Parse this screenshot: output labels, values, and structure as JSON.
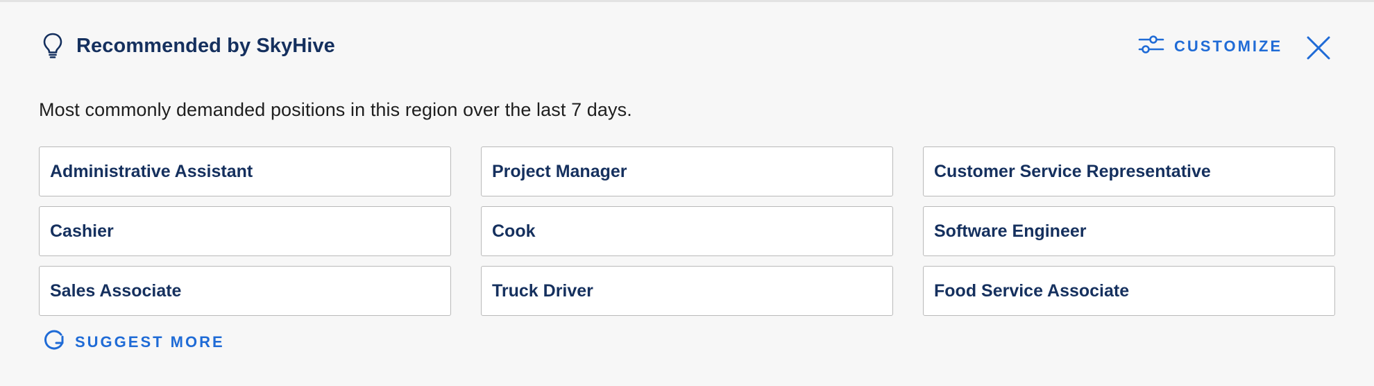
{
  "header": {
    "title": "Recommended by SkyHive",
    "icon": "lightbulb-icon"
  },
  "actions": {
    "customize_label": "CUSTOMIZE",
    "customize_icon": "sliders-icon",
    "close_icon": "close-icon"
  },
  "description": "Most commonly demanded positions in this region over the last 7 days.",
  "positions": [
    "Administrative Assistant",
    "Project Manager",
    "Customer Service Representative",
    "Cashier",
    "Cook",
    "Software Engineer",
    "Sales Associate",
    "Truck Driver",
    "Food Service Associate"
  ],
  "suggest": {
    "label": "SUGGEST MORE",
    "icon": "refresh-icon"
  },
  "colors": {
    "title": "#15305e",
    "accent": "#1f6bd6",
    "background": "#f7f7f7",
    "card_border": "#b9b9b9"
  }
}
